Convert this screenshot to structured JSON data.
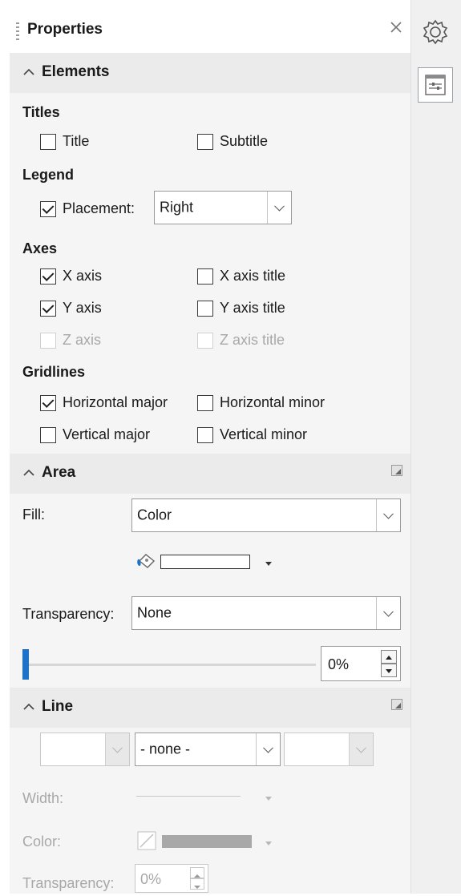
{
  "panel": {
    "title": "Properties"
  },
  "elements": {
    "header": "Elements",
    "titles": {
      "heading": "Titles",
      "title": "Title",
      "subtitle": "Subtitle",
      "title_checked": false,
      "subtitle_checked": false
    },
    "legend": {
      "heading": "Legend",
      "placement_label": "Placement:",
      "placement_value": "Right",
      "checked": true
    },
    "axes": {
      "heading": "Axes",
      "x_axis": "X axis",
      "y_axis": "Y axis",
      "z_axis": "Z axis",
      "x_axis_title": "X axis title",
      "y_axis_title": "Y axis title",
      "z_axis_title": "Z axis title"
    },
    "gridlines": {
      "heading": "Gridlines",
      "horizontal_major": "Horizontal major",
      "horizontal_minor": "Horizontal minor",
      "vertical_major": "Vertical major",
      "vertical_minor": "Vertical minor"
    }
  },
  "area": {
    "header": "Area",
    "fill_label": "Fill:",
    "fill_value": "Color",
    "transparency_label": "Transparency:",
    "transparency_value": "None",
    "transparency_percent": "0%",
    "slider_fraction": 0
  },
  "line": {
    "header": "Line",
    "style_value": "",
    "dash_value": "- none -",
    "arrow_value": "",
    "width_label": "Width:",
    "color_label": "Color:",
    "transparency_label": "Transparency:",
    "transparency_value": "0%"
  },
  "colors": {
    "accent": "#1e73c8",
    "section_bg": "#f5f5f5",
    "section_header": "#ebebeb"
  },
  "icons": {
    "settings": "gear-icon",
    "properties": "properties-icon",
    "close": "close-icon"
  }
}
